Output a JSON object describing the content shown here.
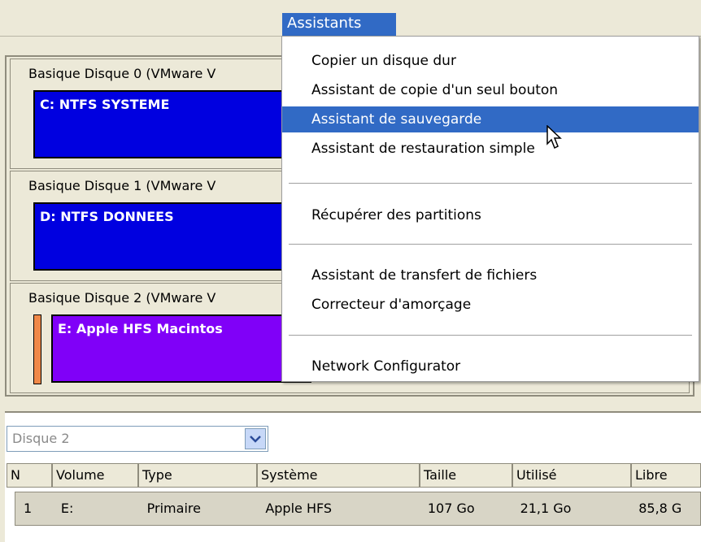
{
  "menubar": {
    "active_menu": "Assistants"
  },
  "disks": [
    {
      "label": "Basique Disque 0 (VMware V",
      "partition": "C: NTFS SYSTEME",
      "color": "#0000e0"
    },
    {
      "label": "Basique Disque 1 (VMware V",
      "partition": "D: NTFS DONNEES",
      "color": "#0000e0"
    },
    {
      "label": "Basique Disque 2 (VMware V",
      "partition": "E: Apple HFS Macintos",
      "color": "#8000f8"
    }
  ],
  "menu_items": [
    "Copier un disque dur",
    "Assistant de copie d'un seul bouton",
    "Assistant de sauvegarde",
    "Assistant de restauration simple",
    "Récupérer des partitions",
    "Assistant de transfert de fichiers",
    "Correcteur d'amorçage",
    "Network Configurator"
  ],
  "highlighted_item": "Assistant de sauvegarde",
  "disk_select": {
    "value": "Disque 2"
  },
  "table": {
    "columns": [
      "N",
      "Volume",
      "Type",
      "Système",
      "Taille",
      "Utilisé",
      "Libre"
    ],
    "rows": [
      [
        "1",
        "E:",
        "Primaire",
        "Apple HFS",
        "107 Go",
        "21,1 Go",
        "85,8 G"
      ]
    ]
  },
  "colors": {
    "highlight": "#316ac5",
    "partition_blue": "#0000e0",
    "partition_purple": "#8000f8",
    "strip": "#f08848"
  }
}
